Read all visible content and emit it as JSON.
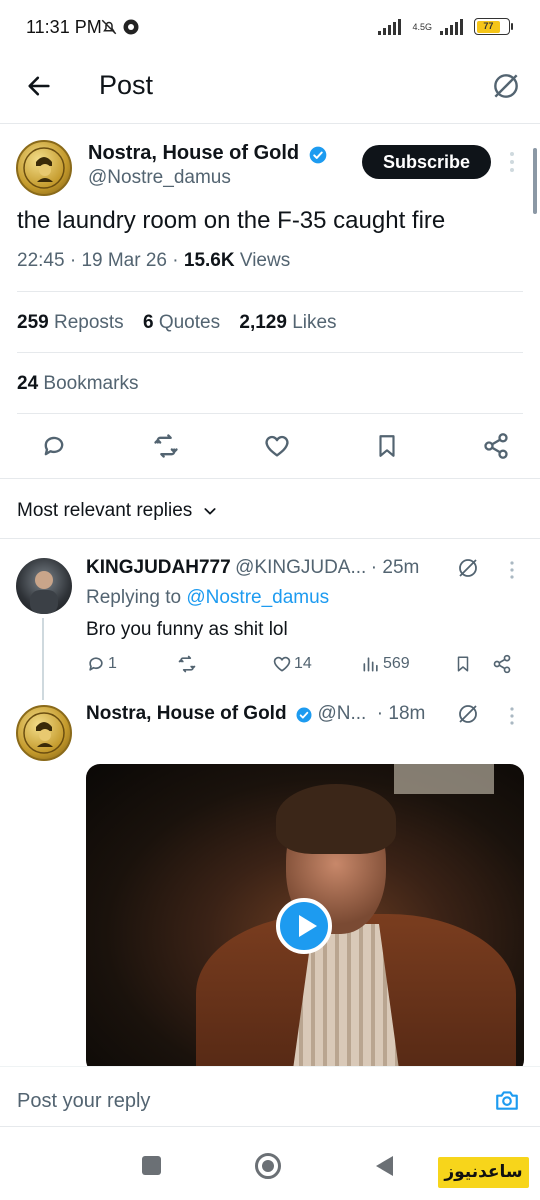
{
  "status_bar": {
    "time": "11:31 PM",
    "network": "4.5G",
    "battery": "77"
  },
  "header": {
    "title": "Post"
  },
  "post": {
    "author_name": "Nostra, House of Gold",
    "author_handle": "@Nostre_damus",
    "subscribe_label": "Subscribe",
    "text": "the laundry room on the F-35 caught fire",
    "time": "22:45",
    "date": "19 Mar 26",
    "views_count": "15.6K",
    "views_label": "Views",
    "stats": {
      "reposts_count": "259",
      "reposts_label": "Reposts",
      "quotes_count": "6",
      "quotes_label": "Quotes",
      "likes_count": "2,129",
      "likes_label": "Likes",
      "bookmarks_count": "24",
      "bookmarks_label": "Bookmarks"
    }
  },
  "replies_sort": {
    "label": "Most relevant replies"
  },
  "replies": [
    {
      "name": "KINGJUDAH777",
      "handle": "@KINGJUDA...",
      "time": "· 25m",
      "replying_prefix": "Replying to",
      "replying_handle": "@Nostre_damus",
      "text": "Bro you funny as shit lol",
      "reply_count": "1",
      "like_count": "14",
      "view_count": "569"
    },
    {
      "name": "Nostra, House of Gold",
      "handle": "@N...",
      "time": "· 18m"
    }
  ],
  "compose": {
    "placeholder": "Post your reply"
  },
  "watermark": {
    "text": "ساعدنیوز"
  },
  "colors": {
    "accent": "#1d9bf0",
    "text": "#0f1419",
    "secondary": "#536471",
    "watermark": "#f7d51b"
  }
}
